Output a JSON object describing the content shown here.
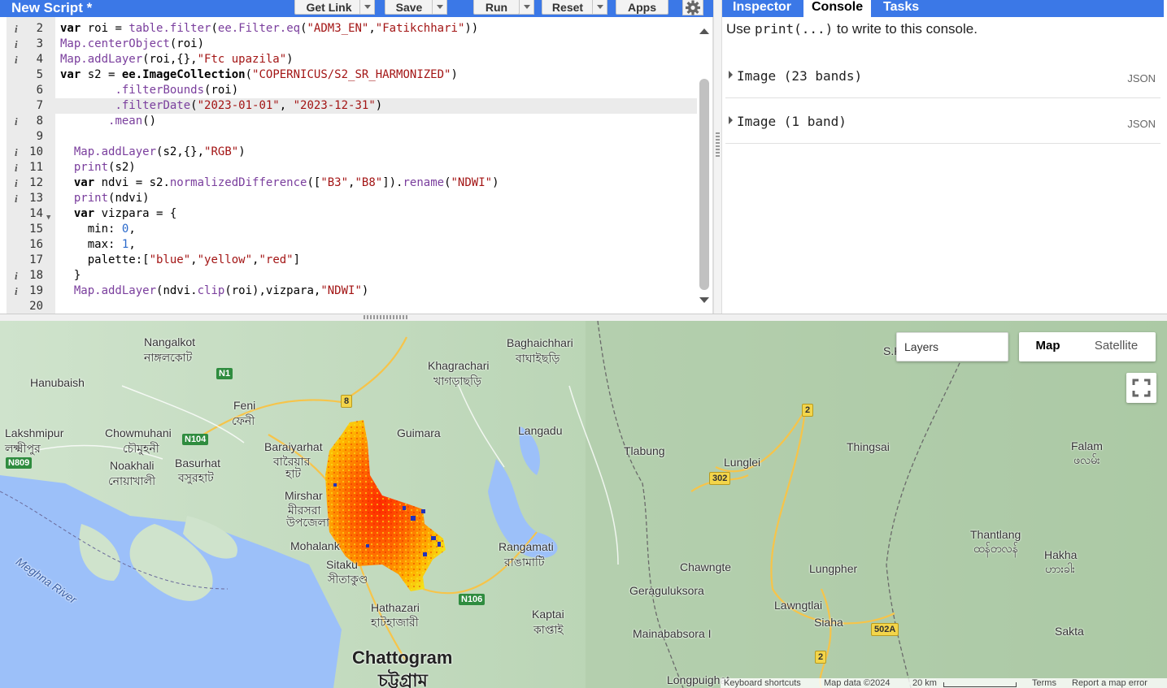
{
  "header": {
    "title": "New Script *",
    "buttons": {
      "get_link": "Get Link",
      "save": "Save",
      "run": "Run",
      "reset": "Reset",
      "apps": "Apps"
    }
  },
  "editor": {
    "lines": [
      {
        "n": "2",
        "info": true
      },
      {
        "n": "3",
        "info": true
      },
      {
        "n": "4",
        "info": true
      },
      {
        "n": "5",
        "info": false
      },
      {
        "n": "6",
        "info": false
      },
      {
        "n": "7",
        "info": false
      },
      {
        "n": "8",
        "info": true
      },
      {
        "n": "9",
        "info": false
      },
      {
        "n": "10",
        "info": true
      },
      {
        "n": "11",
        "info": true
      },
      {
        "n": "12",
        "info": true
      },
      {
        "n": "13",
        "info": true
      },
      {
        "n": "14",
        "info": false
      },
      {
        "n": "15",
        "info": false
      },
      {
        "n": "16",
        "info": false
      },
      {
        "n": "17",
        "info": false
      },
      {
        "n": "18",
        "info": true
      },
      {
        "n": "19",
        "info": true
      },
      {
        "n": "20",
        "info": false
      }
    ],
    "code": {
      "l2": [
        "var",
        " roi = ",
        "table.filter",
        "(",
        "ee.Filter.eq",
        "(",
        "\"ADM3_EN\"",
        ",",
        "\"Fatikchhari\"",
        "))"
      ],
      "l3": [
        "Map.centerObject",
        "(roi)"
      ],
      "l4": [
        "Map.addLayer",
        "(roi,{},",
        "\"Ftc upazila\"",
        ")"
      ],
      "l5": [
        "var",
        " s2 = ",
        "ee.ImageCollection",
        "(",
        "\"COPERNICUS/S2_SR_HARMONIZED\"",
        ")"
      ],
      "l6": [
        ".filterBounds",
        "(roi)"
      ],
      "l7": [
        ".filterDate",
        "(",
        "\"2023-01-01\"",
        ", ",
        "\"2023-12-31\"",
        ")"
      ],
      "l8": [
        ".mean",
        "()"
      ],
      "l10": [
        "Map.addLayer",
        "(s2,{},",
        "\"RGB\"",
        ")"
      ],
      "l11": [
        "print",
        "(s2)"
      ],
      "l12": [
        "var",
        " ndvi = s2.",
        "normalizedDifference",
        "([",
        "\"B3\"",
        ",",
        "\"B8\"",
        "]).",
        "rename",
        "(",
        "\"NDWI\"",
        ")"
      ],
      "l13": [
        "print",
        "(ndvi)"
      ],
      "l14": [
        "var",
        " vizpara = {"
      ],
      "l15": [
        "min: ",
        "0",
        ","
      ],
      "l16": [
        "max: ",
        "1",
        ","
      ],
      "l17": [
        "palette:[",
        "\"blue\"",
        ",",
        "\"yellow\"",
        ",",
        "\"red\"",
        "]"
      ],
      "l18": [
        "}"
      ],
      "l19": [
        "Map.addLayer",
        "(ndvi.",
        "clip",
        "(roi),vizpara,",
        "\"NDWI\"",
        ")"
      ]
    }
  },
  "right_panel": {
    "tabs": [
      "Inspector",
      "Console",
      "Tasks"
    ],
    "active_tab": "Console",
    "hint_prefix": "Use ",
    "hint_code": "print(...)",
    "hint_suffix": " to write to this console.",
    "entries": [
      {
        "label": "Image (23 bands)",
        "json": "JSON"
      },
      {
        "label": "Image (1 band)",
        "json": "JSON"
      }
    ]
  },
  "map": {
    "layers_label": "Layers",
    "map_type": {
      "map": "Map",
      "satellite": "Satellite",
      "selected": "Map"
    },
    "places": [
      {
        "t": "Nangalkot",
        "id": "nangalkot"
      },
      {
        "t": "নাঙ্গলকোট",
        "id": "nangalkot-bn"
      },
      {
        "t": "Hanubaish",
        "id": "hanubaish"
      },
      {
        "t": "Feni",
        "id": "feni"
      },
      {
        "t": "ফেনী",
        "id": "feni-bn"
      },
      {
        "t": "Lakshmipur",
        "id": "lakshmipur"
      },
      {
        "t": "লক্ষ্মীপুর",
        "id": "lakshmipur-bn"
      },
      {
        "t": "Chowmuhani",
        "id": "chowmuhani"
      },
      {
        "t": "চৌমুহনী",
        "id": "chowmuhani-bn"
      },
      {
        "t": "Noakhali",
        "id": "noakhali"
      },
      {
        "t": "নোয়াখালী",
        "id": "noakhali-bn"
      },
      {
        "t": "Basurhat",
        "id": "basurhat"
      },
      {
        "t": "বসুরহাট",
        "id": "basurhat-bn"
      },
      {
        "t": "Baraiyarhat",
        "id": "baraiyarhat"
      },
      {
        "t": "বারৈয়ার",
        "id": "baraiyarhat-bn1"
      },
      {
        "t": "হাট",
        "id": "baraiyarhat-bn2"
      },
      {
        "t": "Mirshar",
        "id": "mirshar"
      },
      {
        "t": "মীরসরা",
        "id": "mirshar-bn1"
      },
      {
        "t": "উপজেলা",
        "id": "mirshar-bn2"
      },
      {
        "t": "Mohalank",
        "id": "mohalank"
      },
      {
        "t": "Sitaku",
        "id": "sitakund"
      },
      {
        "t": "সীতাকুণ্ড",
        "id": "sitakund-bn"
      },
      {
        "t": "Hathazari",
        "id": "hathazari"
      },
      {
        "t": "হাটহাজারী",
        "id": "hathazari-bn"
      },
      {
        "t": "Chattogram",
        "id": "chattogram"
      },
      {
        "t": "চট্টগ্রাম",
        "id": "chattogram-bn"
      },
      {
        "t": "Khagrachari",
        "id": "khagrachari"
      },
      {
        "t": "খাগড়াছড়ি",
        "id": "khagrachari-bn"
      },
      {
        "t": "Baghaichhari",
        "id": "baghaichhari"
      },
      {
        "t": "বাঘাইছড়ি",
        "id": "baghaichhari-bn"
      },
      {
        "t": "Guimara",
        "id": "guimara"
      },
      {
        "t": "Langadu",
        "id": "langadu"
      },
      {
        "t": "Rangamati",
        "id": "rangamati"
      },
      {
        "t": "রাঙামাটি",
        "id": "rangamati-bn"
      },
      {
        "t": "Kaptai",
        "id": "kaptai"
      },
      {
        "t": "কাপ্তাই",
        "id": "kaptai-bn"
      },
      {
        "t": "Tlabung",
        "id": "tlabung"
      },
      {
        "t": "Lunglei",
        "id": "lunglei"
      },
      {
        "t": "Chawngte",
        "id": "chawngte"
      },
      {
        "t": "Geraguluksora",
        "id": "geraguluksora"
      },
      {
        "t": "Mainababsora I",
        "id": "mainababsora"
      },
      {
        "t": "Lawngtlai",
        "id": "lawngtlai"
      },
      {
        "t": "Siaha",
        "id": "siaha"
      },
      {
        "t": "Lungpher",
        "id": "lungpher"
      },
      {
        "t": "Thingsai",
        "id": "thingsai"
      },
      {
        "t": "Falam",
        "id": "falam"
      },
      {
        "t": "ဖလမ်း",
        "id": "falam-my"
      },
      {
        "t": "Thantlang",
        "id": "thantlang"
      },
      {
        "t": "ထန်တလန်",
        "id": "thantlang-my"
      },
      {
        "t": "Hakha",
        "id": "hakha"
      },
      {
        "t": "ဟားခါး",
        "id": "hakha-my"
      },
      {
        "t": "Sakta",
        "id": "sakta"
      },
      {
        "t": "Longpuighat",
        "id": "longpuighat"
      },
      {
        "t": "S.K",
        "id": "sk"
      },
      {
        "t": "Meghna River",
        "id": "meghna"
      }
    ],
    "shields": [
      {
        "t": "N1",
        "id": "n1",
        "c": "g"
      },
      {
        "t": "8",
        "id": "r8",
        "c": "y"
      },
      {
        "t": "N104",
        "id": "n104",
        "c": "g"
      },
      {
        "t": "N809",
        "id": "n809",
        "c": "g"
      },
      {
        "t": "N106",
        "id": "n106",
        "c": "g"
      },
      {
        "t": "2",
        "id": "r2a",
        "c": "y"
      },
      {
        "t": "302",
        "id": "r302",
        "c": "y"
      },
      {
        "t": "502A",
        "id": "r502a",
        "c": "y"
      },
      {
        "t": "2",
        "id": "r2b",
        "c": "y"
      }
    ],
    "attribution": {
      "shortcuts": "Keyboard shortcuts",
      "data": "Map data ©2024",
      "scale": "20 km",
      "terms": "Terms",
      "report": "Report a map error"
    },
    "colors": {
      "land": "#cfe3cc",
      "water": "#9cc0f9",
      "road": "#f6c44a",
      "ndwi_palette": [
        "blue",
        "yellow",
        "red"
      ]
    }
  }
}
